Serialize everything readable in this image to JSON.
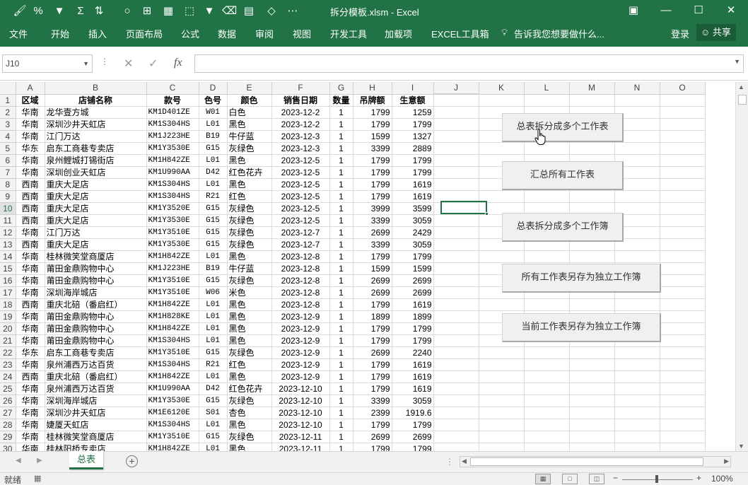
{
  "title": "拆分模板.xlsm  -  Excel",
  "qat_icons": [
    "brush-icon",
    "percent-icon",
    "filter-icon",
    "autosum-icon",
    "sort-icon",
    "circle-icon",
    "insert-icon",
    "grid-icon",
    "grid-dashed-icon",
    "filter-icon",
    "eraser-icon",
    "table-icon",
    "shape-icon",
    "more-icon"
  ],
  "window_controls": {
    "restore": "▣",
    "minimize": "—",
    "maximize": "☐",
    "close": "✕"
  },
  "ribbon": {
    "file": "文件",
    "tabs": [
      "开始",
      "插入",
      "页面布局",
      "公式",
      "数据",
      "审阅",
      "视图",
      "开发工具",
      "加载项",
      "EXCEL工具箱"
    ],
    "tellme": "告诉我您想要做什么...",
    "login": "登录",
    "share": "共享"
  },
  "formula_bar": {
    "name_box": "J10",
    "cancel": "✕",
    "enter": "✓",
    "fx": "fx",
    "formula": ""
  },
  "columns": [
    "A",
    "B",
    "C",
    "D",
    "E",
    "F",
    "G",
    "H",
    "I",
    "J",
    "K",
    "L",
    "M",
    "N",
    "O"
  ],
  "header_row": [
    "区域",
    "店铺名称",
    "款号",
    "色号",
    "颜色",
    "销售日期",
    "数量",
    "吊牌额",
    "生意额"
  ],
  "rows": [
    [
      "华南",
      "龙华壹方城",
      "KM1D401ZE",
      "W01",
      "白色",
      "2023-12-2",
      "1",
      "1799",
      "1259"
    ],
    [
      "华南",
      "深圳沙井天虹店",
      "KM1S304HS",
      "L01",
      "黑色",
      "2023-12-2",
      "1",
      "1799",
      "1799"
    ],
    [
      "华南",
      "江门万达",
      "KM1J223HE",
      "B19",
      "牛仔蓝",
      "2023-12-3",
      "1",
      "1599",
      "1327"
    ],
    [
      "华东",
      "启东工商巷专卖店",
      "KM1Y3530E",
      "G15",
      "灰绿色",
      "2023-12-3",
      "1",
      "3399",
      "2889"
    ],
    [
      "华南",
      "泉州鲤城打锡街店",
      "KM1H842ZE",
      "L01",
      "黑色",
      "2023-12-5",
      "1",
      "1799",
      "1799"
    ],
    [
      "华南",
      "深圳创业天虹店",
      "KM1U990AA",
      "D42",
      "红色花卉",
      "2023-12-5",
      "1",
      "1799",
      "1799"
    ],
    [
      "西南",
      "重庆大足店",
      "KM1S304HS",
      "L01",
      "黑色",
      "2023-12-5",
      "1",
      "1799",
      "1619"
    ],
    [
      "西南",
      "重庆大足店",
      "KM1S304HS",
      "R21",
      "红色",
      "2023-12-5",
      "1",
      "1799",
      "1619"
    ],
    [
      "西南",
      "重庆大足店",
      "KM1Y3520E",
      "G15",
      "灰绿色",
      "2023-12-5",
      "1",
      "3999",
      "3599"
    ],
    [
      "西南",
      "重庆大足店",
      "KM1Y3530E",
      "G15",
      "灰绿色",
      "2023-12-5",
      "1",
      "3399",
      "3059"
    ],
    [
      "华南",
      "江门万达",
      "KM1Y3510E",
      "G15",
      "灰绿色",
      "2023-12-7",
      "1",
      "2699",
      "2429"
    ],
    [
      "西南",
      "重庆大足店",
      "KM1Y3530E",
      "G15",
      "灰绿色",
      "2023-12-7",
      "1",
      "3399",
      "3059"
    ],
    [
      "华南",
      "桂林微笑堂商厦店",
      "KM1H842ZE",
      "L01",
      "黑色",
      "2023-12-8",
      "1",
      "1799",
      "1799"
    ],
    [
      "华南",
      "莆田金鼎购物中心",
      "KM1J223HE",
      "B19",
      "牛仔蓝",
      "2023-12-8",
      "1",
      "1599",
      "1599"
    ],
    [
      "华南",
      "莆田金鼎购物中心",
      "KM1Y3510E",
      "G15",
      "灰绿色",
      "2023-12-8",
      "1",
      "2699",
      "2699"
    ],
    [
      "华南",
      "深圳海岸城店",
      "KM1Y3510E",
      "W06",
      "米色",
      "2023-12-8",
      "1",
      "2699",
      "2699"
    ],
    [
      "西南",
      "重庆北碚（番启红）",
      "KM1H842ZE",
      "L01",
      "黑色",
      "2023-12-8",
      "1",
      "1799",
      "1619"
    ],
    [
      "华南",
      "莆田金鼎购物中心",
      "KM1H828KE",
      "L01",
      "黑色",
      "2023-12-9",
      "1",
      "1899",
      "1899"
    ],
    [
      "华南",
      "莆田金鼎购物中心",
      "KM1H842ZE",
      "L01",
      "黑色",
      "2023-12-9",
      "1",
      "1799",
      "1799"
    ],
    [
      "华南",
      "莆田金鼎购物中心",
      "KM1S304HS",
      "L01",
      "黑色",
      "2023-12-9",
      "1",
      "1799",
      "1799"
    ],
    [
      "华东",
      "启东工商巷专卖店",
      "KM1Y3510E",
      "G15",
      "灰绿色",
      "2023-12-9",
      "1",
      "2699",
      "2240"
    ],
    [
      "华南",
      "泉州浦西万达百货",
      "KM1S304HS",
      "R21",
      "红色",
      "2023-12-9",
      "1",
      "1799",
      "1619"
    ],
    [
      "西南",
      "重庆北碚（番启红）",
      "KM1H842ZE",
      "L01",
      "黑色",
      "2023-12-9",
      "1",
      "1799",
      "1619"
    ],
    [
      "华南",
      "泉州浦西万达百货",
      "KM1U990AA",
      "D42",
      "红色花卉",
      "2023-12-10",
      "1",
      "1799",
      "1619"
    ],
    [
      "华南",
      "深圳海岸城店",
      "KM1Y3530E",
      "G15",
      "灰绿色",
      "2023-12-10",
      "1",
      "3399",
      "3059"
    ],
    [
      "华南",
      "深圳沙井天虹店",
      "KM1E6120E",
      "S01",
      "杏色",
      "2023-12-10",
      "1",
      "2399",
      "1919.6"
    ],
    [
      "华南",
      "婕厦天虹店",
      "KM1S304HS",
      "L01",
      "黑色",
      "2023-12-10",
      "1",
      "1799",
      "1799"
    ],
    [
      "华南",
      "桂林微笑堂商厦店",
      "KM1Y3510E",
      "G15",
      "灰绿色",
      "2023-12-11",
      "1",
      "2699",
      "2699"
    ],
    [
      "华南",
      "桂林阳桥专卖店",
      "KM1H842ZE",
      "L01",
      "黑色",
      "2023-12-11",
      "1",
      "1799",
      "1799"
    ]
  ],
  "macro_buttons": [
    "总表拆分成多个工作表",
    "汇总所有工作表",
    "总表拆分成多个工作簿",
    "所有工作表另存为独立工作簿",
    "当前工作表另存为独立工作簿"
  ],
  "sheet_tabs": [
    "总表"
  ],
  "status": {
    "ready": "就绪",
    "zoom": "100%",
    "zoom_minus": "−",
    "zoom_plus": "+"
  }
}
